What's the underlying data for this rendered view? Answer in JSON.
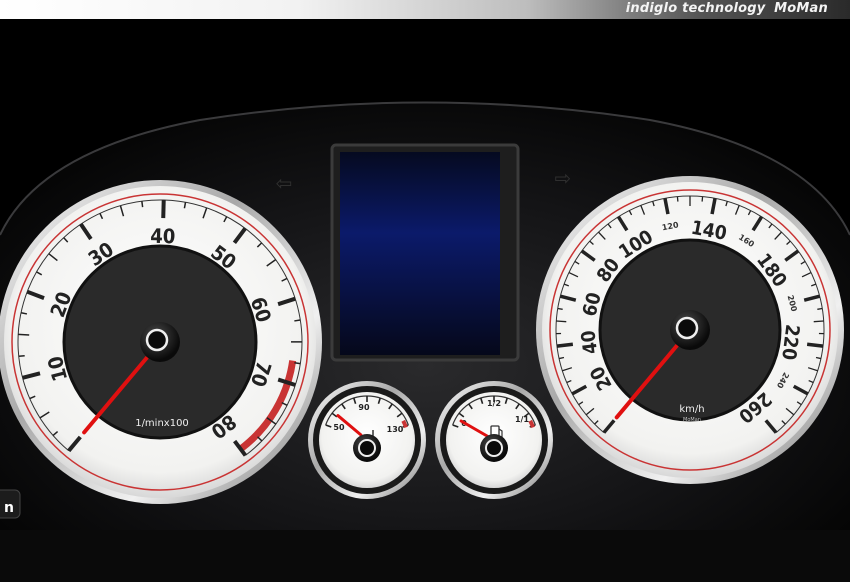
{
  "banner": {
    "text": "indiglo technology",
    "brand": "MoMan"
  },
  "colors": {
    "needle": "#e01010",
    "face": "#f6f6f4",
    "inner": "#2a2a2a",
    "ring": "#c93434",
    "chrome": "#d9d9d9"
  },
  "tachometer": {
    "ticks": [
      "10",
      "20",
      "30",
      "40",
      "50",
      "60",
      "70",
      "80"
    ],
    "unit": "1/minx100",
    "needle_rpm": 0
  },
  "speedometer": {
    "ticks": [
      "20",
      "40",
      "60",
      "80",
      "100",
      "140",
      "180",
      "220",
      "260"
    ],
    "minor_ticks": [
      "120",
      "160",
      "200",
      "240"
    ],
    "unit": "km/h",
    "maker": "MoMan",
    "needle_kmh": 0
  },
  "temperature_gauge": {
    "labels": [
      "50",
      "90",
      "130"
    ],
    "icon": "coolant-temp-icon"
  },
  "fuel_gauge": {
    "labels": [
      "0",
      "1/2",
      "1/1"
    ],
    "icon": "fuel-pump-icon"
  },
  "side_label": "n"
}
